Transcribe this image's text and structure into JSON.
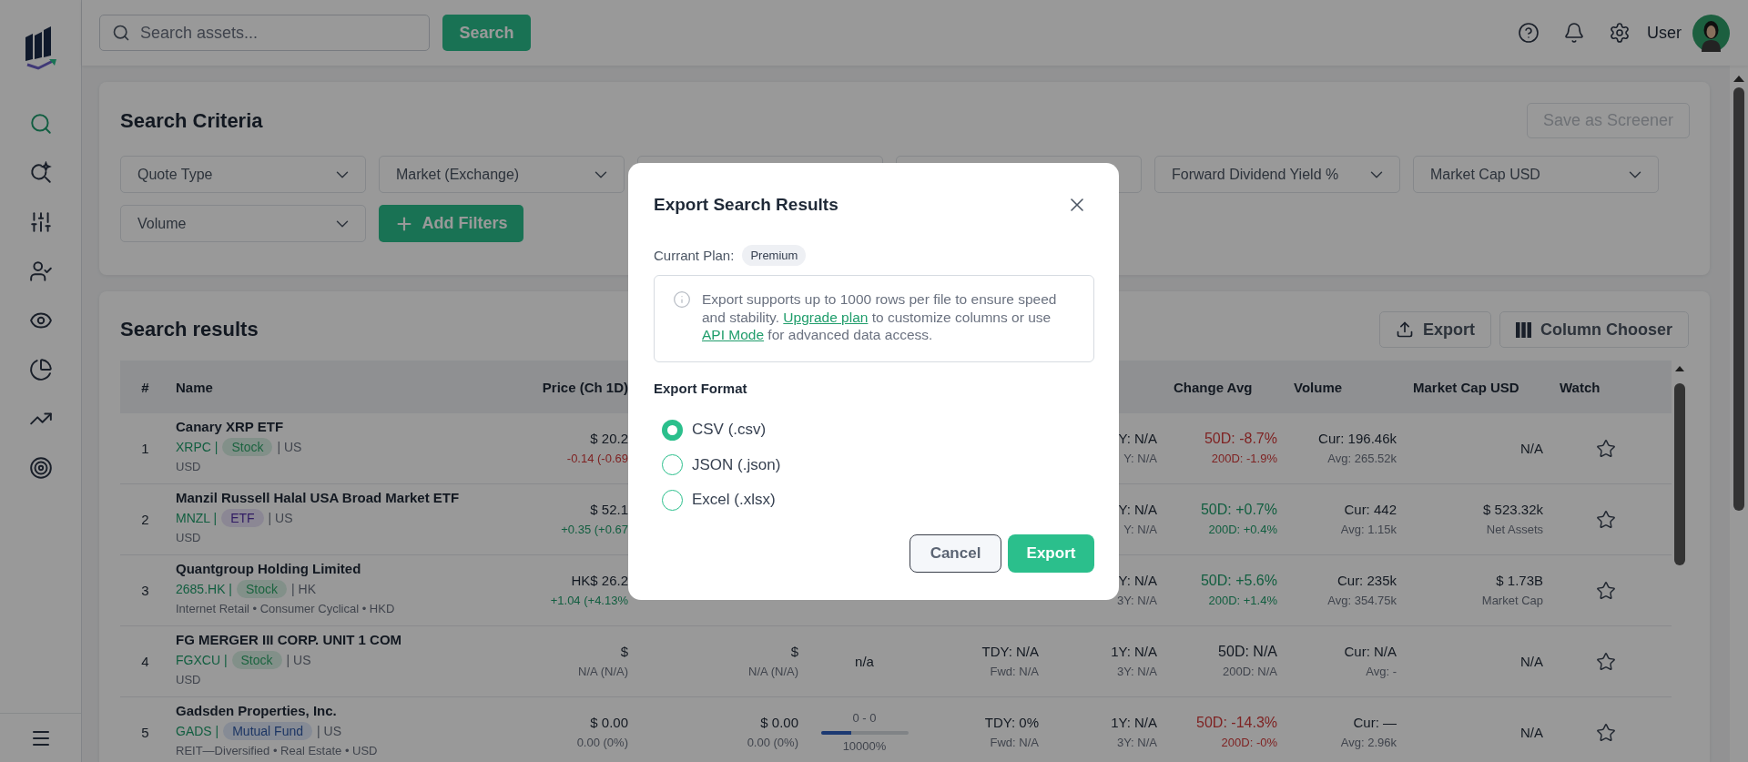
{
  "sidebar": {
    "items": [
      {
        "kind": "search",
        "selected": true
      },
      {
        "kind": "ai-search",
        "selected": false
      },
      {
        "kind": "sliders",
        "selected": false
      },
      {
        "kind": "user-check",
        "selected": false
      },
      {
        "kind": "eye",
        "selected": false
      },
      {
        "kind": "pie",
        "selected": false
      },
      {
        "kind": "trend",
        "selected": false
      },
      {
        "kind": "target",
        "selected": false
      }
    ]
  },
  "topbar": {
    "search": {
      "placeholder": "Search assets..."
    },
    "search_button": "Search",
    "user": "User"
  },
  "search_criteria": {
    "title": "Search Criteria",
    "save_button": {
      "label": "Save as Screener",
      "disabled": true
    },
    "filters": [
      {
        "kind": "dropdown",
        "label": "Quote Type"
      },
      {
        "kind": "dropdown",
        "label": "Market (Exchange)"
      },
      {
        "kind": "covered"
      },
      {
        "kind": "covered"
      },
      {
        "kind": "dropdown",
        "label": "Forward Dividend Yield %"
      },
      {
        "kind": "dropdown",
        "label": "Market Cap USD"
      },
      {
        "kind": "dropdown",
        "label": "Volume"
      },
      {
        "kind": "add",
        "label": "Add Filters"
      }
    ]
  },
  "search_results": {
    "title": "Search results",
    "buttons": [
      {
        "kind": "export",
        "label": "Export"
      },
      {
        "kind": "columns",
        "label": "Column Chooser"
      }
    ],
    "table": {
      "columns": [
        {
          "label": "#"
        },
        {
          "label": "Name"
        },
        {
          "label": "Price (Ch 1D)"
        },
        {
          "label": "Change Avg"
        },
        {
          "label": "Volume"
        },
        {
          "label": "Market Cap USD"
        },
        {
          "label": "Watch"
        }
      ],
      "rows": [
        {
          "index": "1",
          "name": "Canary XRP ETF",
          "ticker": "XRPC |",
          "tag": {
            "label": "Stock",
            "kind": "stock"
          },
          "region": "| US",
          "detail": "USD",
          "watched": false,
          "cells": {
            "price": [
              {
                "text": "$ 20.2",
                "kind": "main"
              },
              {
                "text": "-0.14 (-0.69",
                "kind": "down"
              }
            ],
            "column_6": [
              {
                "text": "Y: N/A",
                "kind": "main"
              },
              {
                "text": "Y: N/A",
                "kind": "sub"
              }
            ],
            "change_avg": [
              {
                "text": "50D: -8.7%",
                "kind": "down"
              },
              {
                "text": "200D: -1.9%",
                "kind": "down"
              }
            ],
            "volume": [
              {
                "text": "Cur: 196.46k",
                "kind": "main"
              },
              {
                "text": "Avg: 265.52k",
                "kind": "sub"
              }
            ],
            "market_cap": [
              {
                "text": "N/A",
                "kind": "main"
              }
            ]
          }
        },
        {
          "index": "2",
          "name": "Manzil Russell Halal USA Broad Market ETF",
          "ticker": "MNZL |",
          "tag": {
            "label": "ETF",
            "kind": "etf"
          },
          "region": "| US",
          "detail": "USD",
          "watched": false,
          "cells": {
            "price": [
              {
                "text": "$ 52.1",
                "kind": "main"
              },
              {
                "text": "+0.35 (+0.67",
                "kind": "up"
              }
            ],
            "column_6": [
              {
                "text": "Y: N/A",
                "kind": "main"
              },
              {
                "text": "Y: N/A",
                "kind": "sub"
              }
            ],
            "change_avg": [
              {
                "text": "50D: +0.7%",
                "kind": "up"
              },
              {
                "text": "200D: +0.4%",
                "kind": "up"
              }
            ],
            "volume": [
              {
                "text": "Cur: 442",
                "kind": "main"
              },
              {
                "text": "Avg: 1.15k",
                "kind": "sub"
              }
            ],
            "market_cap": [
              {
                "text": "$ 523.32k",
                "kind": "main"
              },
              {
                "text": "Net Assets",
                "kind": "sub"
              }
            ]
          }
        },
        {
          "index": "3",
          "name": "Quantgroup Holding Limited",
          "ticker": "2685.HK |",
          "tag": {
            "label": "Stock",
            "kind": "stock"
          },
          "region": "| HK",
          "detail": "Internet Retail • Consumer Cyclical • HKD",
          "watched": false,
          "cells": {
            "price": [
              {
                "text": "HK$ 26.2",
                "kind": "main"
              },
              {
                "text": "+1.04 (+4.13%",
                "kind": "up"
              }
            ],
            "column_6": [
              {
                "text": "Y: N/A",
                "kind": "main"
              },
              {
                "text": "3Y: N/A",
                "kind": "sub"
              }
            ],
            "change_avg": [
              {
                "text": "50D: +5.6%",
                "kind": "up"
              },
              {
                "text": "200D: +1.4%",
                "kind": "up"
              }
            ],
            "volume": [
              {
                "text": "Cur: 235k",
                "kind": "main"
              },
              {
                "text": "Avg: 354.75k",
                "kind": "sub"
              }
            ],
            "market_cap": [
              {
                "text": "$ 1.73B",
                "kind": "main"
              },
              {
                "text": "Market Cap",
                "kind": "sub"
              }
            ]
          }
        },
        {
          "index": "4",
          "name": "FG MERGER III CORP. UNIT 1 COM",
          "ticker": "FGXCU |",
          "tag": {
            "label": "Stock",
            "kind": "stock"
          },
          "region": "| US",
          "detail": "USD",
          "watched": false,
          "cells": {
            "price": [
              {
                "text": "$",
                "kind": "main"
              },
              {
                "text": "N/A (N/A)",
                "kind": "sub"
              }
            ],
            "column_3": [
              {
                "text": "$",
                "kind": "main"
              },
              {
                "text": "N/A (N/A)",
                "kind": "sub"
              }
            ],
            "column_4": [
              {
                "text": "n/a",
                "kind": "main"
              }
            ],
            "column_5": [
              {
                "text": "TDY: N/A",
                "kind": "main"
              },
              {
                "text": "Fwd: N/A",
                "kind": "sub"
              }
            ],
            "column_6": [
              {
                "text": "1Y: N/A",
                "kind": "main"
              },
              {
                "text": "3Y: N/A",
                "kind": "sub"
              }
            ],
            "change_avg": [
              {
                "text": "50D: N/A",
                "kind": "main"
              },
              {
                "text": "200D: N/A",
                "kind": "sub"
              }
            ],
            "volume": [
              {
                "text": "Cur: N/A",
                "kind": "main"
              },
              {
                "text": "Avg: -",
                "kind": "sub"
              }
            ],
            "market_cap": [
              {
                "text": "N/A",
                "kind": "main"
              }
            ]
          }
        },
        {
          "index": "5",
          "name": "Gadsden Properties, Inc.",
          "ticker": "GADS |",
          "tag": {
            "label": "Mutual Fund",
            "kind": "fund"
          },
          "region": "| US",
          "detail": "REIT—Diversified • Real Estate • USD",
          "watched": false,
          "cells": {
            "price": [
              {
                "text": "$ 0.00",
                "kind": "main"
              },
              {
                "text": "0.00 (0%)",
                "kind": "sub"
              }
            ],
            "column_3": [
              {
                "text": "$ 0.00",
                "kind": "main"
              },
              {
                "text": "0.00 (0%)",
                "kind": "sub"
              }
            ],
            "column_4": {
              "range": "0 - 0",
              "level": 0.35,
              "reading": "10000%"
            },
            "column_5": [
              {
                "text": "TDY: 0%",
                "kind": "main"
              },
              {
                "text": "Fwd: N/A",
                "kind": "sub"
              }
            ],
            "column_6": [
              {
                "text": "1Y: N/A",
                "kind": "main"
              },
              {
                "text": "3Y: N/A",
                "kind": "sub"
              }
            ],
            "change_avg": [
              {
                "text": "50D: -14.3%",
                "kind": "down"
              },
              {
                "text": "200D: -0%",
                "kind": "down"
              }
            ],
            "volume": [
              {
                "text": "Cur: —",
                "kind": "main"
              },
              {
                "text": "Avg: 2.96k",
                "kind": "sub"
              }
            ],
            "market_cap": [
              {
                "text": "N/A",
                "kind": "main"
              }
            ]
          }
        }
      ]
    }
  },
  "export_dialog": {
    "title": "Export Search Results",
    "plan_label": "Currant Plan:",
    "plan_badge": "Premium",
    "notice": [
      {
        "kind": "text",
        "text": "Export supports up to 1000 rows per file to ensure speed and stability. "
      },
      {
        "kind": "link",
        "text": "Upgrade plan"
      },
      {
        "kind": "text",
        "text": " to customize columns or use "
      },
      {
        "kind": "link",
        "text": "API Mode"
      },
      {
        "kind": "text",
        "text": " for advanced data access."
      }
    ],
    "format_label": "Export Format",
    "formats": [
      {
        "label": "CSV (.csv)",
        "selected": true
      },
      {
        "label": "JSON (.json)",
        "selected": false
      },
      {
        "label": "Excel (.xlsx)",
        "selected": false
      }
    ],
    "buttons": [
      {
        "kind": "secondary",
        "label": "Cancel"
      },
      {
        "kind": "primary",
        "label": "Export"
      }
    ]
  }
}
